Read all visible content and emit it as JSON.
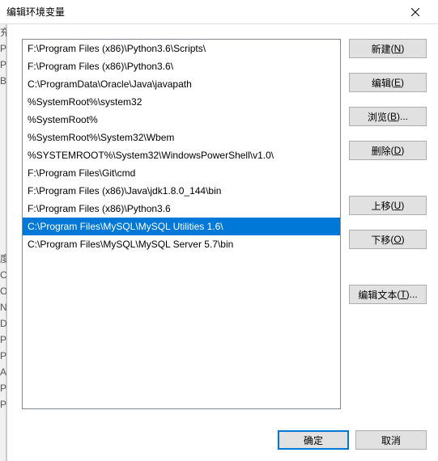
{
  "titlebar": {
    "title": "编辑环境变量"
  },
  "list": {
    "selected_index": 10,
    "items": [
      "F:\\Program Files (x86)\\Python3.6\\Scripts\\",
      "F:\\Program Files (x86)\\Python3.6\\",
      "C:\\ProgramData\\Oracle\\Java\\javapath",
      "%SystemRoot%\\system32",
      "%SystemRoot%",
      "%SystemRoot%\\System32\\Wbem",
      "%SYSTEMROOT%\\System32\\WindowsPowerShell\\v1.0\\",
      "F:\\Program Files\\Git\\cmd",
      "F:\\Program Files (x86)\\Java\\jdk1.8.0_144\\bin",
      "F:\\Program Files (x86)\\Python3.6",
      "C:\\Program Files\\MySQL\\MySQL Utilities 1.6\\",
      "C:\\Program Files\\MySQL\\MySQL Server 5.7\\bin"
    ]
  },
  "buttons": {
    "new": {
      "label": "新建",
      "accel": "N"
    },
    "edit": {
      "label": "编辑",
      "accel": "E"
    },
    "browse": {
      "label": "浏览",
      "accel": "B",
      "suffix": "..."
    },
    "delete": {
      "label": "删除",
      "accel": "D"
    },
    "moveup": {
      "label": "上移",
      "accel": "U"
    },
    "movedown": {
      "label": "下移",
      "accel": "O"
    },
    "edittext": {
      "label": "编辑文本",
      "accel": "T",
      "suffix": "..."
    }
  },
  "footer": {
    "ok": {
      "label": "确定"
    },
    "cancel": {
      "label": "取消"
    }
  }
}
